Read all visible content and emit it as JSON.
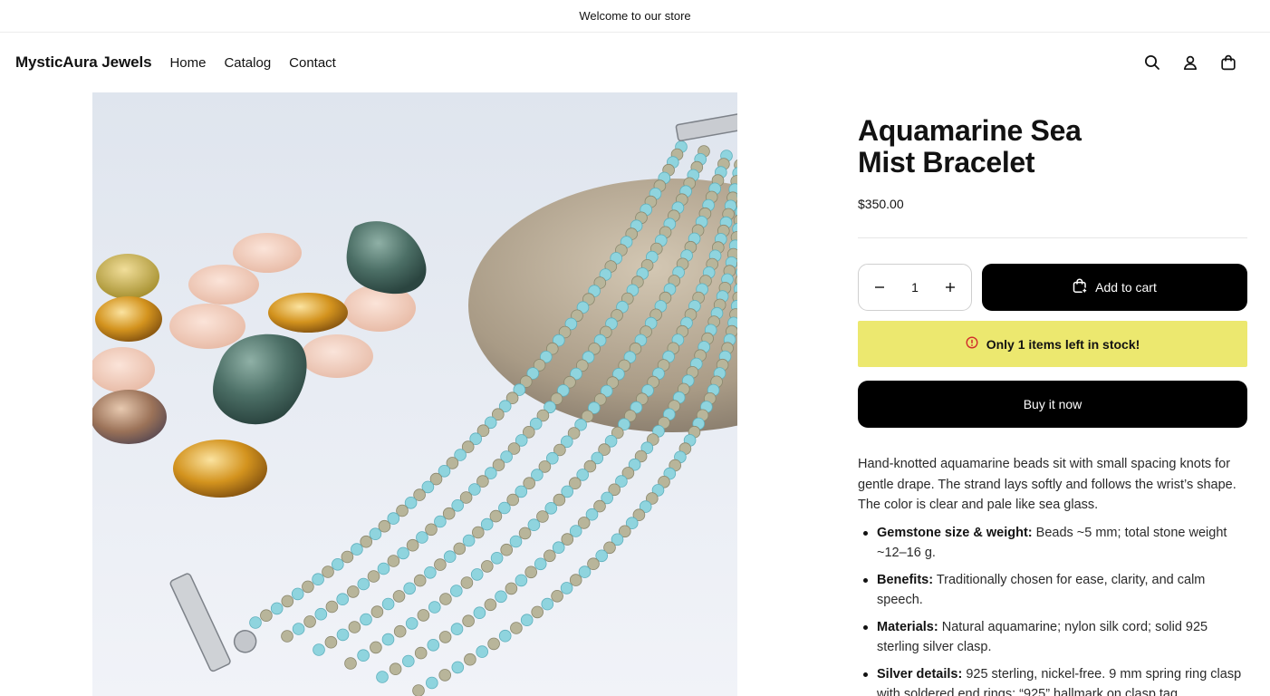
{
  "announcement": "Welcome to our store",
  "header": {
    "logo": "MysticAura Jewels",
    "nav": [
      "Home",
      "Catalog",
      "Contact"
    ],
    "icons": [
      "search-icon",
      "account-icon",
      "cart-icon"
    ]
  },
  "product": {
    "image_alt": "Aquamarine multi-strand bracelet on a stone with polished gemstones",
    "title": "Aquamarine Sea Mist Bracelet",
    "price": "$350.00",
    "quantity": "1",
    "add_to_cart": "Add to cart",
    "stock_notice": "Only 1 items left in stock!",
    "buy_now": "Buy it now",
    "description": "Hand-knotted aquamarine beads sit with small spacing knots for gentle drape. The strand lays softly and follows the wrist’s shape. The color is clear and pale like sea glass.",
    "features": [
      {
        "label": "Gemstone size & weight:",
        "text": " Beads ~5 mm; total stone weight ~12–16 g."
      },
      {
        "label": "Benefits:",
        "text": " Traditionally chosen for ease, clarity, and calm speech."
      },
      {
        "label": "Materials:",
        "text": " Natural aquamarine; nylon silk cord; solid 925 sterling silver clasp."
      },
      {
        "label": "Silver details:",
        "text": " 925 sterling, nickel-free. 9 mm spring ring clasp with soldered end rings; “925” hallmark on clasp tag."
      }
    ]
  },
  "colors": {
    "primary_button": "#000000",
    "stock_banner": "#ece86f",
    "warning_icon": "#d12b2b"
  }
}
